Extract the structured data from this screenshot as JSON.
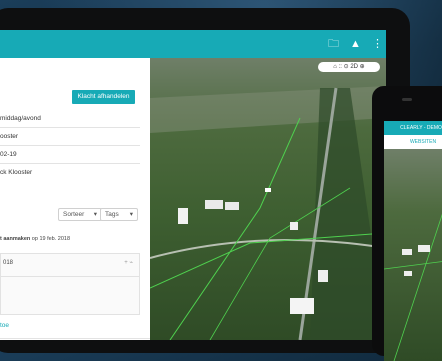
{
  "tablet": {
    "panel": {
      "complete_button": "Klacht afhandelen",
      "rows": [
        "middag/avond",
        "ooster",
        "02-19",
        "ck Klooster"
      ],
      "sort_label": "Sorteer",
      "tags_label": "Tags",
      "note_strong": "t aanmaken",
      "note_date": "op 19 feb. 2018",
      "card_title": "018",
      "card_tag_icon": "+ ⌁",
      "add_link": "toe",
      "footer_text": "en"
    },
    "map_controls": {
      "home": "⌂",
      "grid": "::",
      "zoom": "⊙",
      "mode": "2D",
      "compass": "⊕",
      "cog": "⚙"
    }
  },
  "phone": {
    "dropdown_label": "CLEARLY - DEMO",
    "tab_label": "WEBSITEN"
  },
  "colors": {
    "accent": "#17aab6"
  }
}
